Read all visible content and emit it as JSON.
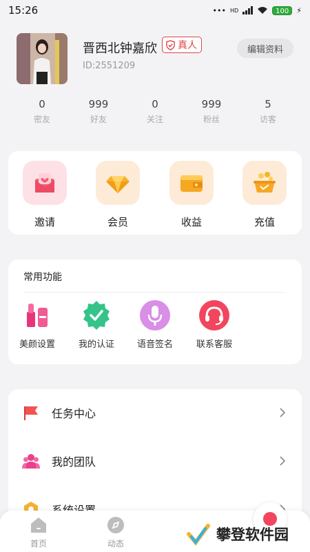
{
  "status_bar": {
    "time": "15:26",
    "network": "HD",
    "battery": "100"
  },
  "profile": {
    "name": "晋西北钟嘉欣",
    "verified_badge": "真人",
    "id_text": "ID:2551209",
    "edit_button": "编辑资料"
  },
  "stats": [
    {
      "value": "0",
      "label": "密友"
    },
    {
      "value": "999",
      "label": "好友"
    },
    {
      "value": "0",
      "label": "关注"
    },
    {
      "value": "999",
      "label": "粉丝"
    },
    {
      "value": "5",
      "label": "访客"
    }
  ],
  "quick_actions": [
    {
      "label": "邀请",
      "icon": "invite-envelope-icon"
    },
    {
      "label": "会员",
      "icon": "vip-diamond-icon"
    },
    {
      "label": "收益",
      "icon": "wallet-icon"
    },
    {
      "label": "充值",
      "icon": "coin-pot-icon"
    }
  ],
  "common_functions": {
    "title": "常用功能",
    "items": [
      {
        "label": "美颜设置",
        "icon": "cosmetics-icon"
      },
      {
        "label": "我的认证",
        "icon": "certified-badge-icon"
      },
      {
        "label": "语音签名",
        "icon": "microphone-icon"
      },
      {
        "label": "联系客服",
        "icon": "headset-icon"
      }
    ]
  },
  "menu_list": [
    {
      "label": "任务中心",
      "icon": "flag-icon"
    },
    {
      "label": "我的团队",
      "icon": "team-icon"
    },
    {
      "label": "系统设置",
      "icon": "settings-icon"
    }
  ],
  "tab_bar": [
    {
      "label": "首页",
      "icon": "home-icon"
    },
    {
      "label": "动态",
      "icon": "compass-icon"
    }
  ],
  "watermark": {
    "text": "攀登软件园"
  },
  "colors": {
    "accent": "#e04444",
    "background": "#f3f3f5",
    "card": "#ffffff",
    "fab_dot": "#f2465e"
  }
}
